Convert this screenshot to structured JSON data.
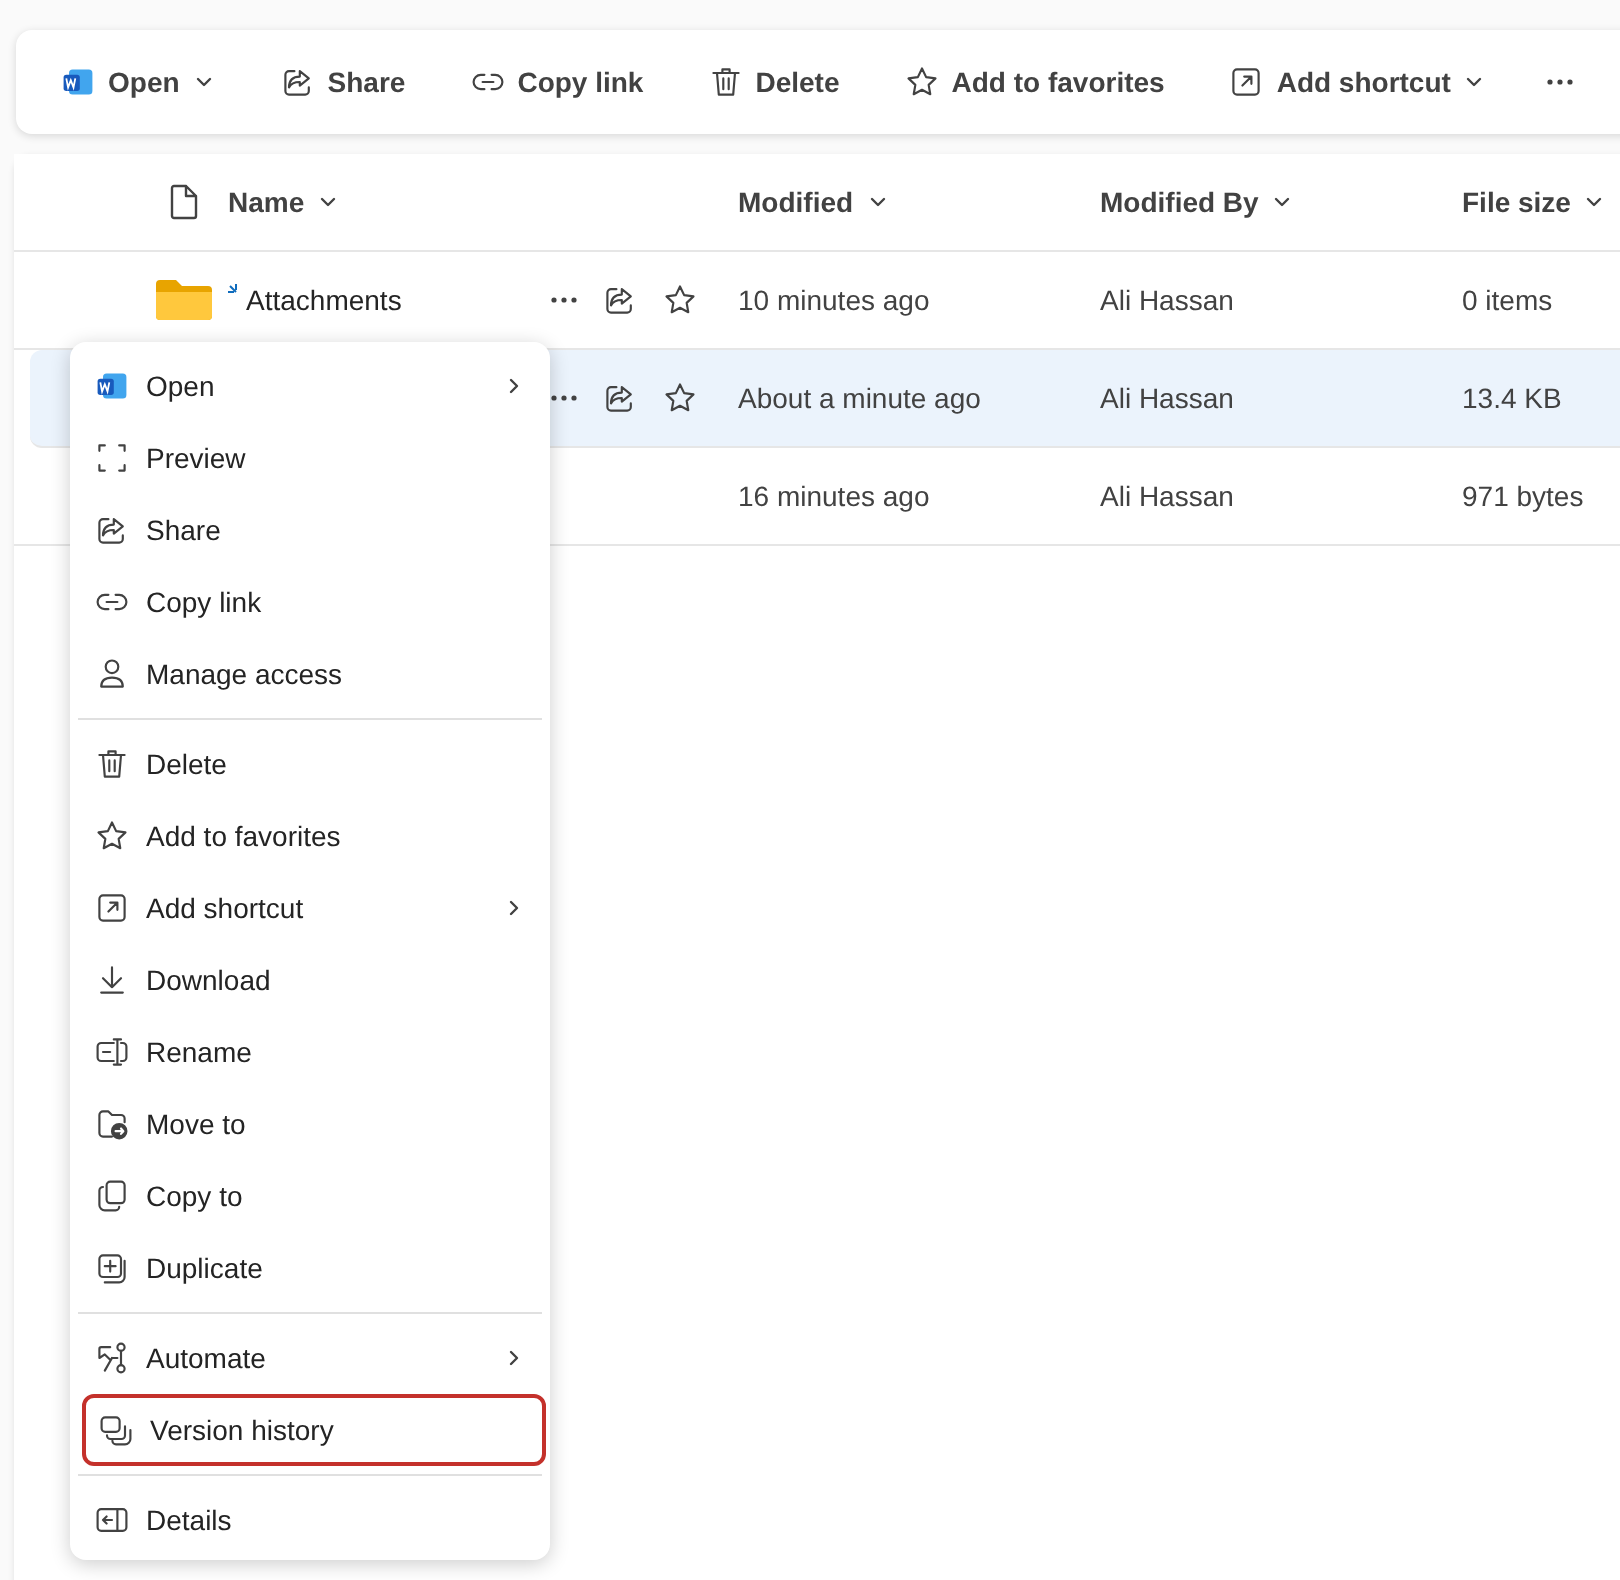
{
  "toolbar": [
    {
      "label": "Open",
      "dropdown": true
    },
    {
      "label": "Share",
      "dropdown": false
    },
    {
      "label": "Copy link",
      "dropdown": false
    },
    {
      "label": "Delete",
      "dropdown": false
    },
    {
      "label": "Add to favorites",
      "dropdown": false
    },
    {
      "label": "Add shortcut",
      "dropdown": true
    }
  ],
  "table": {
    "columns": [
      "Name",
      "Modified",
      "Modified By",
      "File size"
    ],
    "rows": [
      {
        "kind": "folder",
        "name": "Attachments",
        "new": true,
        "selected": false,
        "show_actions": true,
        "modified": "10 minutes ago",
        "modified_by": "Ali Hassan",
        "file_size": "0 items"
      },
      {
        "selected": true,
        "show_actions": true,
        "modified": "About a minute ago",
        "modified_by": "Ali Hassan",
        "file_size": "13.4 KB"
      },
      {
        "selected": false,
        "show_actions": false,
        "modified": "16 minutes ago",
        "modified_by": "Ali Hassan",
        "file_size": "971 bytes"
      }
    ]
  },
  "context_menu": {
    "sections": [
      [
        {
          "label": "Open",
          "submenu": true,
          "highlighted": false
        },
        {
          "label": "Preview",
          "submenu": false,
          "highlighted": false
        },
        {
          "label": "Share",
          "submenu": false,
          "highlighted": false
        },
        {
          "label": "Copy link",
          "submenu": false,
          "highlighted": false
        },
        {
          "label": "Manage access",
          "submenu": false,
          "highlighted": false
        }
      ],
      [
        {
          "label": "Delete",
          "submenu": false,
          "highlighted": false
        },
        {
          "label": "Add to favorites",
          "submenu": false,
          "highlighted": false
        },
        {
          "label": "Add shortcut",
          "submenu": true,
          "highlighted": false
        },
        {
          "label": "Download",
          "submenu": false,
          "highlighted": false
        },
        {
          "label": "Rename",
          "submenu": false,
          "highlighted": false
        },
        {
          "label": "Move to",
          "submenu": false,
          "highlighted": false
        },
        {
          "label": "Copy to",
          "submenu": false,
          "highlighted": false
        },
        {
          "label": "Duplicate",
          "submenu": false,
          "highlighted": false
        }
      ],
      [
        {
          "label": "Automate",
          "submenu": true,
          "highlighted": false
        },
        {
          "label": "Version history",
          "submenu": false,
          "highlighted": true
        }
      ],
      [
        {
          "label": "Details",
          "submenu": false,
          "highlighted": false
        }
      ]
    ]
  }
}
